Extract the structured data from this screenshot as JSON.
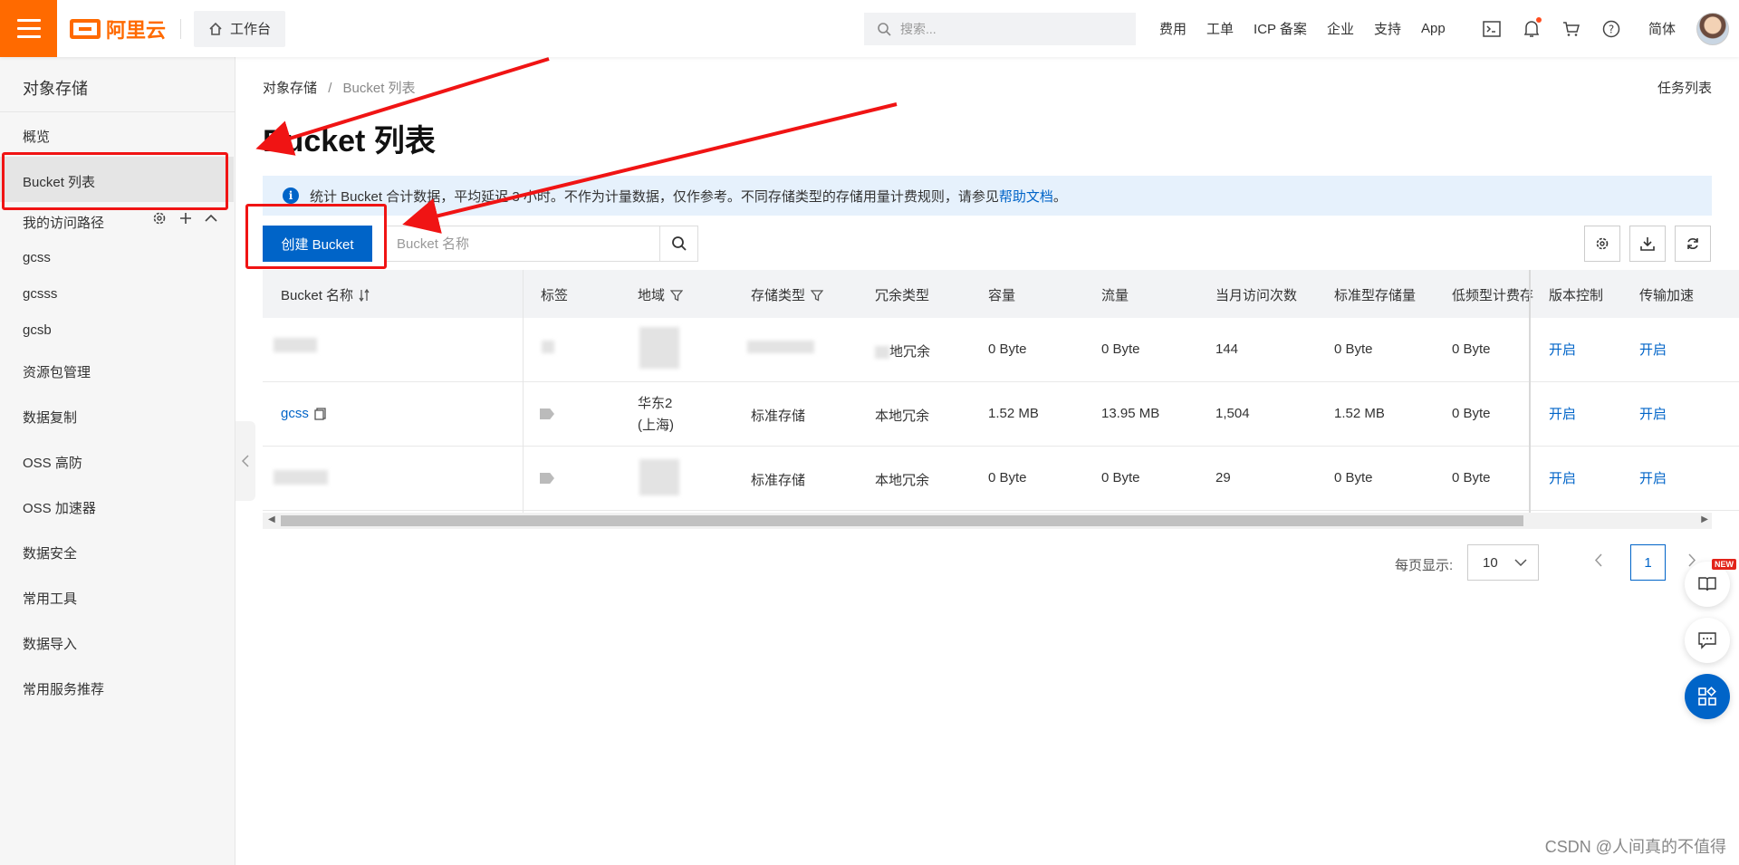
{
  "topbar": {
    "logo_text": "阿里云",
    "workbench_label": "工作台",
    "search_placeholder": "搜索...",
    "nav": [
      "费用",
      "工单",
      "ICP 备案",
      "企业",
      "支持",
      "App"
    ],
    "lang": "简体",
    "brand_color": "#ff6a00"
  },
  "sidebar": {
    "title": "对象存储",
    "items": {
      "overview": "概览",
      "bucket_list": "Bucket 列表",
      "my_paths": "我的访问路径",
      "path_1": "gcss",
      "path_2": "gcsss",
      "path_3": "gcsb",
      "resource_pkg": "资源包管理",
      "data_replication": "数据复制",
      "oss_ddos": "OSS 高防",
      "oss_accelerator": "OSS 加速器",
      "data_security": "数据安全",
      "common_tools": "常用工具",
      "data_import": "数据导入",
      "service_recommend": "常用服务推荐"
    }
  },
  "main": {
    "breadcrumb": {
      "root": "对象存储",
      "sep": "/",
      "current": "Bucket 列表"
    },
    "task_list": "任务列表",
    "title": "Bucket 列表",
    "notice": {
      "text": "统计 Bucket 合计数据，平均延迟 3 小时。不作为计量数据，仅作参考。不同存储类型的存储用量计费规则，请参见",
      "link": "帮助文档",
      "end": "。"
    },
    "create_button": "创建 Bucket",
    "search_placeholder": "Bucket 名称",
    "accent_color": "#0064c8"
  },
  "table": {
    "headers": {
      "name": "Bucket 名称",
      "tags": "标签",
      "region": "地域",
      "storage_class": "存储类型",
      "redundancy": "冗余类型",
      "capacity": "容量",
      "traffic": "流量",
      "monthly_visits": "当月访问次数",
      "standard_storage": "标准型存储量",
      "ia_billing": "低频型计费存",
      "versioning": "版本控制",
      "transfer_accel": "传输加速"
    },
    "rows": [
      {
        "name": "",
        "region_1": "",
        "region_2": "",
        "storage_class": "",
        "redundancy": "地冗余",
        "capacity": "0 Byte",
        "traffic": "0 Byte",
        "visits": "144",
        "standard": "0 Byte",
        "ia": "0 Byte",
        "versioning": "开启",
        "accel": "开启"
      },
      {
        "name": "gcss",
        "region_1": "华东2",
        "region_2": "(上海)",
        "storage_class": "标准存储",
        "redundancy": "本地冗余",
        "capacity": "1.52 MB",
        "traffic": "13.95 MB",
        "visits": "1,504",
        "standard": "1.52 MB",
        "ia": "0 Byte",
        "versioning": "开启",
        "accel": "开启"
      },
      {
        "name": "",
        "region_1": "",
        "region_2": "",
        "storage_class": "标准存储",
        "redundancy": "本地冗余",
        "capacity": "0 Byte",
        "traffic": "0 Byte",
        "visits": "29",
        "standard": "0 Byte",
        "ia": "0 Byte",
        "versioning": "开启",
        "accel": "开启"
      }
    ]
  },
  "pagination": {
    "per_page_label": "每页显示:",
    "per_page_value": "10",
    "current_page": "1"
  },
  "floating": {
    "new_badge": "NEW"
  },
  "watermark": "CSDN @人间真的不值得"
}
